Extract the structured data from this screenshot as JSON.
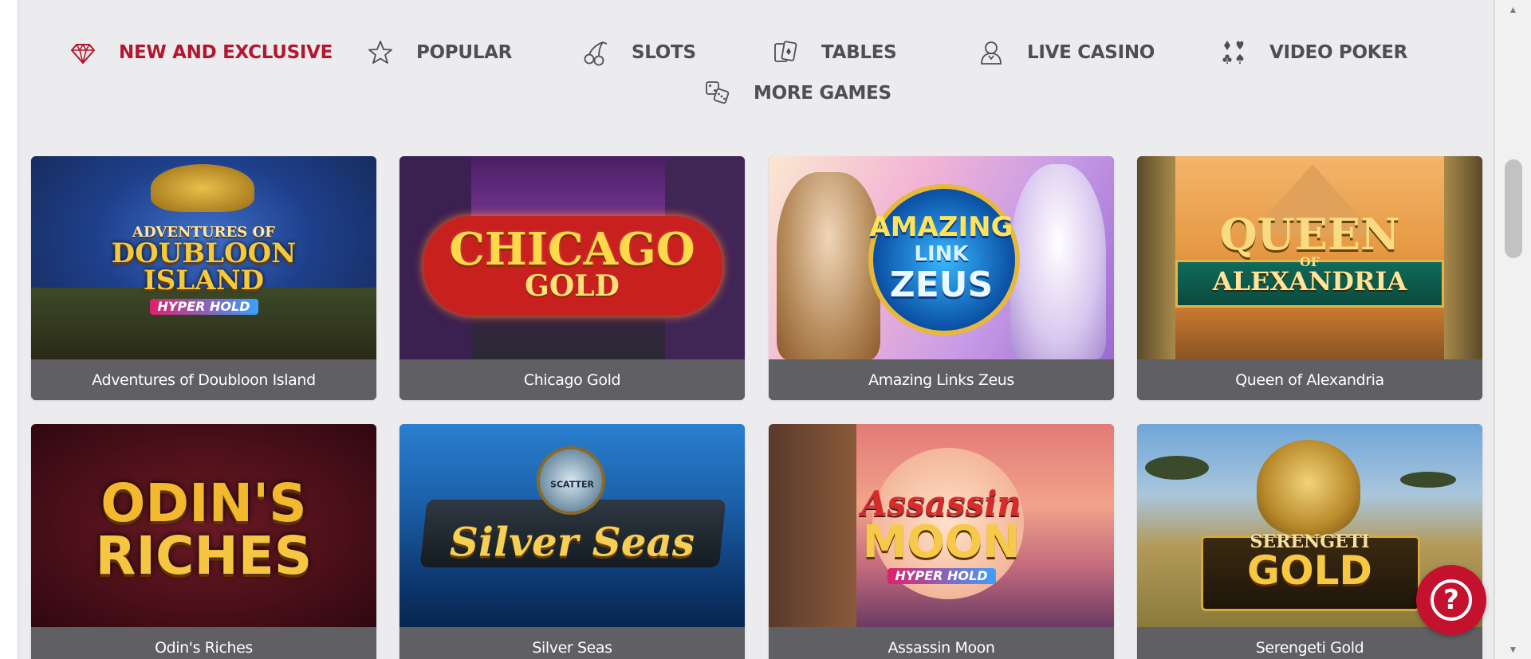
{
  "nav": {
    "items": [
      {
        "label": "NEW AND EXCLUSIVE",
        "icon": "diamond-icon",
        "active": true
      },
      {
        "label": "POPULAR",
        "icon": "star-icon"
      },
      {
        "label": "SLOTS",
        "icon": "cherries-icon"
      },
      {
        "label": "TABLES",
        "icon": "cards-icon"
      },
      {
        "label": "LIVE CASINO",
        "icon": "dealer-icon"
      },
      {
        "label": "VIDEO POKER",
        "icon": "card-suits-icon"
      },
      {
        "label": "MORE GAMES",
        "icon": "dice-icon"
      }
    ]
  },
  "games": [
    {
      "title": "Adventures of Doubloon Island",
      "logo": [
        "ADVENTURES OF",
        "DOUBLOON",
        "ISLAND",
        "HYPER HOLD"
      ]
    },
    {
      "title": "Chicago Gold",
      "logo": [
        "CHICAGO",
        "GOLD"
      ]
    },
    {
      "title": "Amazing Links Zeus",
      "logo": [
        "AMAZING",
        "LINK",
        "ZEUS"
      ]
    },
    {
      "title": "Queen of Alexandria",
      "logo": [
        "QUEEN",
        "OF",
        "ALEXANDRIA"
      ]
    },
    {
      "title": "Odin's Riches",
      "logo": [
        "ODIN'S",
        "RICHES"
      ]
    },
    {
      "title": "Silver Seas",
      "logo": [
        "SCATTER",
        "Silver Seas"
      ]
    },
    {
      "title": "Assassin Moon",
      "logo": [
        "Assassin",
        "MOON",
        "HYPER HOLD"
      ]
    },
    {
      "title": "Serengeti Gold",
      "logo": [
        "SERENGETI",
        "GOLD"
      ]
    }
  ],
  "help": {
    "label": "?"
  },
  "colors": {
    "accent": "#b3162e",
    "nav_text": "#4e4e56",
    "card_title_bg": "#5f5f64",
    "help_button": "#c4122e"
  }
}
